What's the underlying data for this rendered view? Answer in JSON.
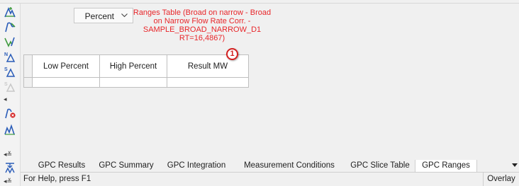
{
  "units_select": {
    "value": "Percent"
  },
  "ranges_table": {
    "title": "Ranges Table (Broad on narrow - Broad on Narrow Flow Rate Corr. - SAMPLE_BROAD_NARROW_D1 RT=16,4867)",
    "columns": [
      "Low Percent",
      "High Percent",
      "Result MW"
    ],
    "rows": [
      [
        "",
        "",
        ""
      ]
    ]
  },
  "callout_number": "1",
  "tabs": [
    {
      "label": "GPC Results",
      "active": false
    },
    {
      "label": "GPC Summary",
      "active": false
    },
    {
      "label": "GPC Integration",
      "active": false
    },
    {
      "label": "Measurement Conditions",
      "active": false
    },
    {
      "label": "GPC Slice Table",
      "active": false
    },
    {
      "label": "GPC Ranges",
      "active": true
    }
  ],
  "status": {
    "help_text": "For Help, press F1",
    "overlay_label": "Overlay"
  },
  "toolbar": {
    "icons": [
      "peak-add-icon",
      "peak-edit-icon",
      "peak-valley-icon",
      "n-delta-icon",
      "s-delta-icon",
      "s-delta-disabled-icon",
      "collapse-left-icon",
      "peak-delete-icon",
      "multi-peak-icon",
      "expand-down-icon",
      "merge-peaks-icon",
      "collapse-section-icon"
    ],
    "colors": {
      "green": "#3f9a3f",
      "blue": "#2b5db8",
      "red": "#d42020"
    }
  }
}
